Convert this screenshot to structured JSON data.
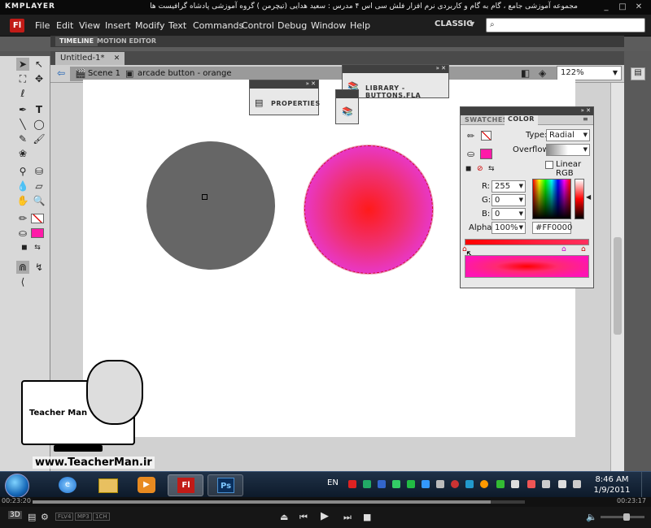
{
  "player": {
    "logo": "KMPLAYER",
    "title": "مجموعه آموزشی جامع ، گام به گام و کاربردی نرم افزار فلش سی اس ۴ مدرس : سعید هدایی (تیچرمن ) گروه آموزشی پادشاه گرافیست ها",
    "time_elapsed": "00:23:20",
    "time_total": "00:23:17",
    "badges": [
      "FLV4",
      "MP3",
      "1CH"
    ],
    "progress": 0.93
  },
  "menubar": {
    "logo": "Fl",
    "items": [
      "File",
      "Edit",
      "View",
      "Insert",
      "Modify",
      "Text",
      "Commands",
      "Control",
      "Debug",
      "Window",
      "Help"
    ],
    "workspace": "CLASSIC",
    "search_placeholder": ""
  },
  "panel_tabs": [
    "TIMELINE",
    "MOTION EDITOR"
  ],
  "document": {
    "tab": "Untitled-1*",
    "crumb_scene": "Scene 1",
    "crumb_symbol": "arcade button - orange",
    "zoom": "122%"
  },
  "floating_panels": {
    "properties": "PROPERTIES",
    "library": "LIBRARY - BUTTONS.FLA"
  },
  "color_panel": {
    "tabs": [
      "SWATCHES",
      "COLOR"
    ],
    "active_tab": "COLOR",
    "type_label": "Type:",
    "type_value": "Radial",
    "overflow_label": "Overflow:",
    "linear_rgb_label": "Linear RGB",
    "r_label": "R:",
    "r_value": "255",
    "g_label": "G:",
    "g_value": "0",
    "b_label": "B:",
    "b_value": "0",
    "alpha_label": "Alpha:",
    "alpha_value": "100%",
    "hex_value": "#FF0000"
  },
  "taskbar": {
    "language": "EN",
    "time": "8:46 AM",
    "date": "1/9/2011",
    "apps": [
      "Fl",
      "Ps"
    ]
  },
  "watermark": {
    "url": "www.TeacherMan.ir",
    "name": "Teacher Man"
  }
}
